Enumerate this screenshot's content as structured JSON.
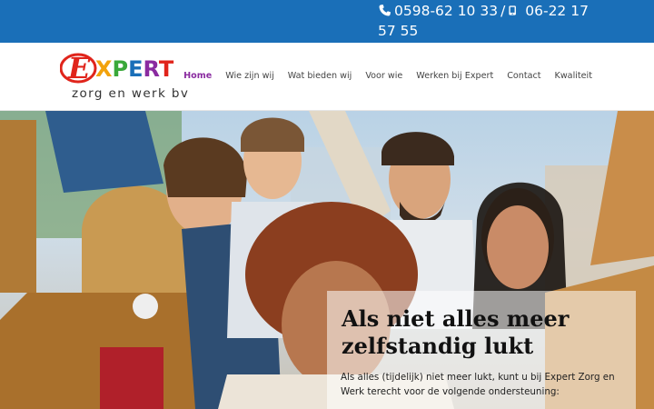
{
  "contact": {
    "phone1": "0598-62 10 33",
    "separator": "/",
    "phone2": "06-22 17 57 55"
  },
  "logo": {
    "word_first": "E",
    "word_rest": "XPERT",
    "subtitle": "zorg en werk bv"
  },
  "nav": {
    "items": [
      {
        "label": "Home",
        "active": true
      },
      {
        "label": "Wie zijn wij"
      },
      {
        "label": "Wat bieden wij"
      },
      {
        "label": "Voor wie"
      },
      {
        "label": "Werken bij Expert"
      },
      {
        "label": "Contact"
      },
      {
        "label": "Kwaliteit"
      }
    ]
  },
  "hero": {
    "heading": "Als niet alles meer zelfstandig lukt",
    "text": "Als alles (tijdelijk) niet meer lukt, kunt u bij Expert Zorg en Werk terecht voor de volgende ondersteuning:",
    "image": "group-of-smiling-young-people-photo"
  },
  "colors": {
    "topbar": "#1a6fb8",
    "nav_active": "#8a2ba0",
    "logo_e": "#e0241b",
    "logo_x": "#f2a20c",
    "logo_p": "#3aa83a",
    "logo_e2": "#1a6fb8",
    "logo_r": "#8a2ba0",
    "logo_t": "#e0241b"
  }
}
